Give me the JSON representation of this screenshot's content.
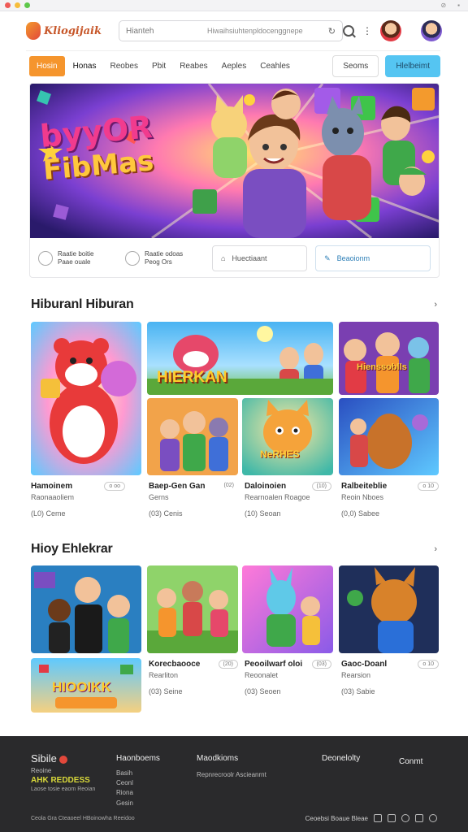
{
  "window": {
    "dots": [
      "#ef5b57",
      "#f6bd3c",
      "#5ec74a"
    ]
  },
  "header": {
    "logo_text": "Kliogijaik",
    "search_placeholder": "Hianteh",
    "search_hint": "Hiwaihsiuhtenpldocenggnepe",
    "icons": [
      "refresh-icon",
      "search-icon",
      "kebab-icon"
    ]
  },
  "nav": {
    "items": [
      "Hosin",
      "Honas",
      "Reobes",
      "Pbit",
      "Reabes",
      "Aeples",
      "Ceahles"
    ],
    "active_index": 0,
    "secondary_button": "Seoms",
    "primary_button": "Hlelbeimt"
  },
  "hero": {
    "title_line1": "byyOR",
    "title_line2": "FibMas",
    "action1_line1": "Raatie boitie",
    "action1_line2": "Paae ouale",
    "action2_line1": "Raatie odoas",
    "action2_line2": "Peog Ors",
    "button1": "Huectiaant",
    "button2": "Beaoionm"
  },
  "section1": {
    "title": "Hiburanl Hiburan",
    "arrow": "›",
    "banner_text": "HIERKAN",
    "tile_texts": [
      "Hienssoblls",
      "NeRHES"
    ],
    "items": [
      {
        "title": "Hamoinem",
        "badge": "o oo",
        "sub": "Raonaaoliem",
        "meta": "(L0) Ceme"
      },
      {
        "title": "Baep-Gen Gan",
        "badge": "(02)",
        "sub": "Gerns",
        "meta": "(03) Cenis"
      },
      {
        "title": "Daloinoien",
        "badge": "(10)",
        "sub": "Rearnoalen Roagoe",
        "meta": "(10) Seoan"
      },
      {
        "title": "Ralbeiteblie",
        "badge": "o 10",
        "sub": "Reoin Nboes",
        "meta": "(0,0) Sabee"
      }
    ]
  },
  "section2": {
    "title": "Hioy Ehlekrar",
    "arrow": "›",
    "banner_text": "HIOOIKK",
    "items": [
      {
        "title": "Korecbaooce",
        "badge": "(20)",
        "sub": "Rearliton",
        "meta": "(03) Seine"
      },
      {
        "title": "Peooilwarf oloi",
        "badge": "(03)",
        "sub": "Reoonalet",
        "meta": "(03) Seoen"
      },
      {
        "title": "Gaoc-Doanl",
        "badge": "o 10",
        "sub": "Rearsion",
        "meta": "(03) Sabie"
      }
    ]
  },
  "footer": {
    "brand": "Sibile",
    "brand_sub": "Reoine",
    "brand_highlight": "AHK REDDESS",
    "brand_tag": "Laose tosie eaom Reoian",
    "col1_title": "Haonboems",
    "col1_items": [
      "Basih",
      "Ceonl",
      "Riona",
      "Gesin"
    ],
    "col2_title": "Maodkioms",
    "col2_items": [
      "Repnrecroolr Ascieanrnt"
    ],
    "col3_title": "Deonelolty",
    "col4_title": "Conmt",
    "copyright": "Ceola Gra Cteaoeel HBoinowha Reeidoo",
    "links": "Ceoebsi Boaue Bleae",
    "social_icons": [
      "grid-icon",
      "mail-icon",
      "circle-icon",
      "camera-icon",
      "globe-icon"
    ]
  }
}
